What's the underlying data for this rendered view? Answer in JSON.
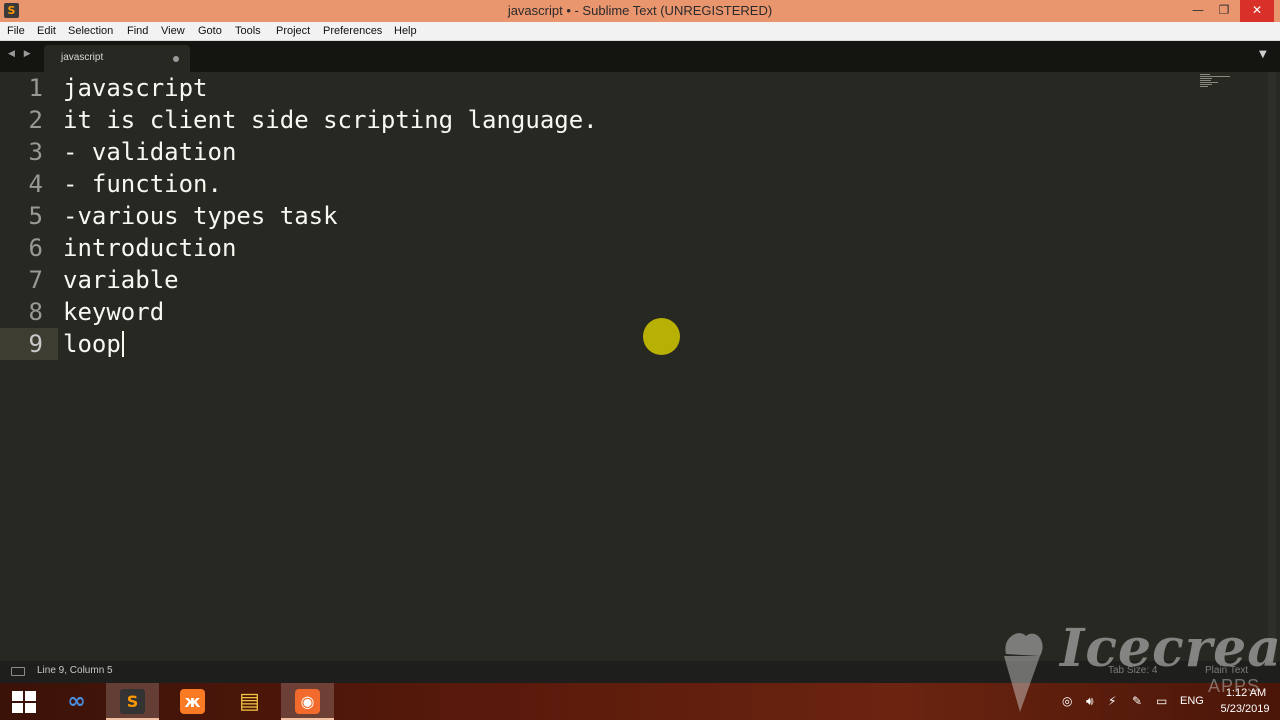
{
  "window": {
    "title": "javascript • - Sublime Text (UNREGISTERED)",
    "app_icon": "S",
    "minimize_glyph": "—",
    "maximize_glyph": "❐",
    "close_glyph": "✕"
  },
  "menu": {
    "items": [
      "File",
      "Edit",
      "Selection",
      "Find",
      "View",
      "Goto",
      "Tools",
      "Project",
      "Preferences",
      "Help"
    ]
  },
  "tabs": {
    "nav_arrows": "◀ ▶",
    "active_tab": {
      "label": "javascript",
      "dirty": true
    },
    "dropdown_glyph": "▼"
  },
  "editor": {
    "lines": [
      {
        "number": "1",
        "text": "javascript"
      },
      {
        "number": "2",
        "text": "it is client side scripting language."
      },
      {
        "number": "3",
        "text": "- validation"
      },
      {
        "number": "4",
        "text": "- function."
      },
      {
        "number": "5",
        "text": "-various types task"
      },
      {
        "number": "6",
        "text": "introduction"
      },
      {
        "number": "7",
        "text": "variable"
      },
      {
        "number": "8",
        "text": "keyword"
      },
      {
        "number": "9",
        "text": "loop"
      }
    ],
    "current_line": 9,
    "colors": {
      "background": "#272822",
      "text": "#f8f8f2",
      "gutter_text": "#9a9a94",
      "mouse_highlight": "#c9bf00"
    }
  },
  "statusbar": {
    "position": "Line 9, Column 5",
    "tab_size": "Tab Size: 4",
    "syntax": "Plain Text"
  },
  "taskbar": {
    "apps": [
      {
        "name": "visual-studio",
        "glyph": "∞",
        "color": "#4a8fe0",
        "active": false
      },
      {
        "name": "sublime-text",
        "glyph": "S",
        "color": "#ff9800",
        "active": true
      },
      {
        "name": "xampp",
        "glyph": "ж",
        "color": "#fb7a24",
        "active": false
      },
      {
        "name": "file-explorer",
        "glyph": "▤",
        "color": "#f5c542",
        "active": false
      },
      {
        "name": "screen-recorder",
        "glyph": "◉",
        "color": "#f26b2c",
        "active": true
      }
    ],
    "tray": {
      "lang": "ENG",
      "time": "1:12 AM",
      "date": "5/23/2019"
    }
  },
  "watermark": {
    "brand": "Icecream",
    "sub": "APPS"
  }
}
